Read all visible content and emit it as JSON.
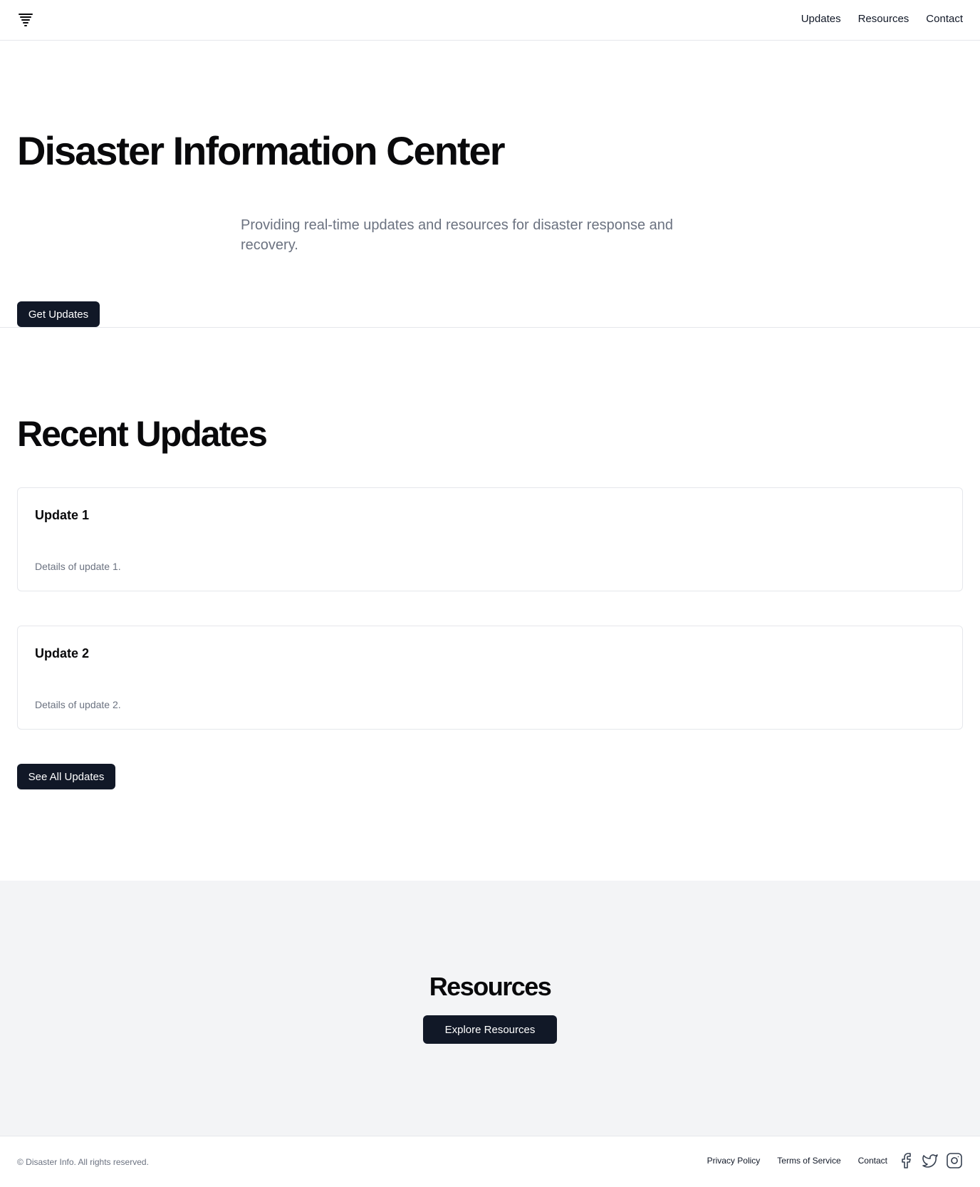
{
  "header": {
    "logo_icon": "tornado-icon",
    "nav": [
      "Updates",
      "Resources",
      "Contact"
    ]
  },
  "hero": {
    "title": "Disaster Information Center",
    "subtitle": "Providing real-time updates and resources for disaster response and recovery.",
    "cta": "Get Updates"
  },
  "updates": {
    "title": "Recent Updates",
    "items": [
      {
        "title": "Update 1",
        "details": "Details of update 1."
      },
      {
        "title": "Update 2",
        "details": "Details of update 2."
      }
    ],
    "cta": "See All Updates"
  },
  "resources": {
    "title": "Resources",
    "cta": "Explore Resources"
  },
  "footer": {
    "copyright": "© Disaster Info. All rights reserved.",
    "links": [
      "Privacy Policy",
      "Terms of Service",
      "Contact"
    ],
    "social_icons": [
      "facebook-icon",
      "twitter-icon",
      "instagram-icon"
    ]
  },
  "colors": {
    "primary": "#111827",
    "muted_text": "#6b7280",
    "border": "#e5e7eb",
    "section_bg": "#f3f4f6"
  }
}
